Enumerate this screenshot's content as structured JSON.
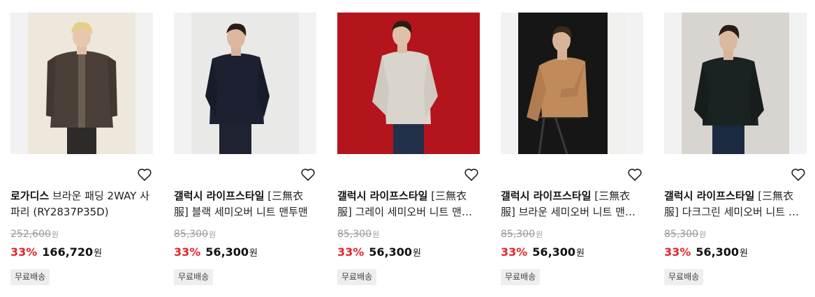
{
  "products": [
    {
      "brand": "로가디스",
      "name": "브라운 패딩 2WAY 사파리 (RY2837P35D)",
      "original_price": "252,600",
      "original_unit": "원",
      "discount_rate": "33%",
      "sale_price": "166,720",
      "sale_unit": "원",
      "badge": "무료배송",
      "photo": {
        "bg": "#ede7dc",
        "frame": "#f3f3f3",
        "top": "#4b4038",
        "bottom": "#2d2a28"
      }
    },
    {
      "brand": "갤럭시 라이프스타일",
      "name": "[三無衣服] 블랙 세미오버 니트 맨투맨",
      "original_price": "85,300",
      "original_unit": "원",
      "discount_rate": "33%",
      "sale_price": "56,300",
      "sale_unit": "원",
      "badge": "무료배송",
      "photo": {
        "bg": "#e9e9e7",
        "frame": "#f3f3f3",
        "top": "#1c2030",
        "bottom": "#1f2230"
      }
    },
    {
      "brand": "갤럭시 라이프스타일",
      "name": "[三無衣服] 그레이 세미오버 니트 맨투맨",
      "original_price": "85,300",
      "original_unit": "원",
      "discount_rate": "33%",
      "sale_price": "56,300",
      "sale_unit": "원",
      "badge": "무료배송",
      "photo": {
        "bg": "#b4141c",
        "frame": "#f3f3f3",
        "top": "#d9d4cc",
        "bottom": "#233049"
      }
    },
    {
      "brand": "갤럭시 라이프스타일",
      "name": "[三無衣服] 브라운 세미오버 니트 맨투맨",
      "original_price": "85,300",
      "original_unit": "원",
      "discount_rate": "33%",
      "sale_price": "56,300",
      "sale_unit": "원",
      "badge": "무료배송",
      "photo": {
        "bg": "#161616",
        "frame": "#f3f3f3",
        "top": "#c08a5a",
        "bottom": "#1e1e1e"
      }
    },
    {
      "brand": "갤럭시 라이프스타일",
      "name": "[三無衣服] 다크그린 세미오버 니트 맨투맨",
      "original_price": "85,300",
      "original_unit": "원",
      "discount_rate": "33%",
      "sale_price": "56,300",
      "sale_unit": "원",
      "badge": "무료배송",
      "photo": {
        "bg": "#d8d5d0",
        "frame": "#f3f3f3",
        "top": "#1b2322",
        "bottom": "#1b2a40"
      }
    }
  ],
  "icons": {
    "wishlist": "heart-outline-icon"
  },
  "colors": {
    "discount": "#e0262e",
    "badge_bg": "#eeeeee",
    "original_price": "#9a9a9a"
  }
}
